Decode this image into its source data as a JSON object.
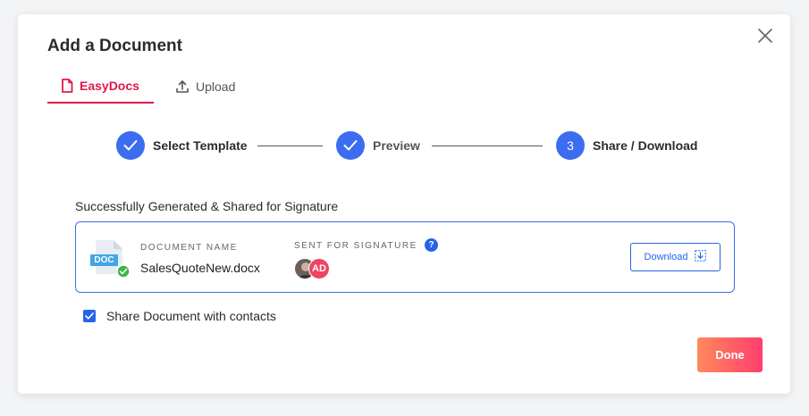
{
  "dialog": {
    "title": "Add a Document"
  },
  "tabs": [
    {
      "label": "EasyDocs",
      "active": true,
      "icon": "document-icon"
    },
    {
      "label": "Upload",
      "active": false,
      "icon": "upload-icon"
    }
  ],
  "stepper": {
    "steps": [
      {
        "label": "Select Template",
        "status": "complete"
      },
      {
        "label": "Preview",
        "status": "complete"
      },
      {
        "number": "3",
        "label": "Share / Download",
        "status": "current"
      }
    ]
  },
  "result": {
    "success_message": "Successfully Generated & Shared for Signature",
    "document_name_label": "DOCUMENT NAME",
    "document_name": "SalesQuoteNew.docx",
    "file_badge": "DOC",
    "sent_label": "SENT FOR SIGNATURE",
    "help_glyph": "?",
    "signer_initials": "AD",
    "download_label": "Download"
  },
  "share": {
    "label": "Share Document with contacts",
    "checked": true
  },
  "actions": {
    "done_label": "Done"
  },
  "colors": {
    "accent_red": "#e0194a",
    "primary_blue": "#3c6cf0",
    "link_blue": "#2563eb",
    "done_gradient_start": "#ff8a5b",
    "done_gradient_end": "#ff3d6e",
    "avatar_red": "#ef4461"
  }
}
